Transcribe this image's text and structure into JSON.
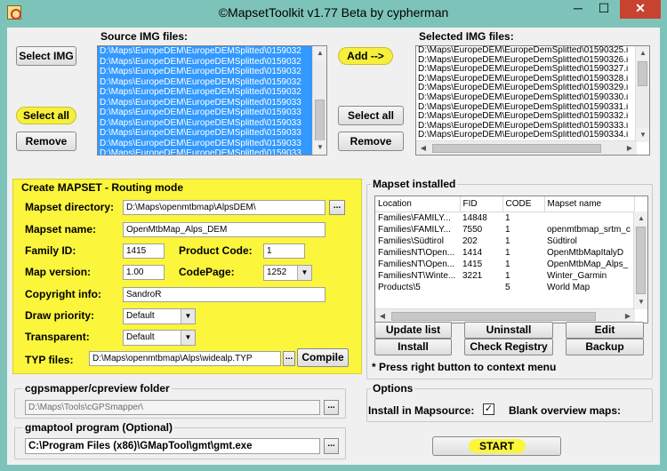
{
  "window": {
    "title": "©MapsetToolkit v1.77 Beta by cypherman",
    "minimize": "─",
    "maximize": "☐",
    "close": "✕"
  },
  "source": {
    "label": "Source IMG files:",
    "select_img": "Select IMG",
    "select_all": "Select all",
    "remove": "Remove",
    "files": [
      "D:\\Maps\\EuropeDEM\\EuropeDEMSplitted\\0159032",
      "D:\\Maps\\EuropeDEM\\EuropeDEMSplitted\\0159032",
      "D:\\Maps\\EuropeDEM\\EuropeDEMSplitted\\0159032",
      "D:\\Maps\\EuropeDEM\\EuropeDEMSplitted\\0159032",
      "D:\\Maps\\EuropeDEM\\EuropeDEMSplitted\\0159032",
      "D:\\Maps\\EuropeDEM\\EuropeDEMSplitted\\0159033",
      "D:\\Maps\\EuropeDEM\\EuropeDEMSplitted\\0159033",
      "D:\\Maps\\EuropeDEM\\EuropeDEMSplitted\\0159033",
      "D:\\Maps\\EuropeDEM\\EuropeDEMSplitted\\0159033",
      "D:\\Maps\\EuropeDEM\\EuropeDEMSplitted\\0159033",
      "D:\\Maps\\EuropeDEM\\EuropeDEMSplitted\\0159033"
    ]
  },
  "add_button": "Add -->",
  "selected": {
    "label": "Selected IMG files:",
    "select_all": "Select all",
    "remove": "Remove",
    "files": [
      "D:\\Maps\\EuropeDEM\\EuropeDemSplitted\\01590325.i",
      "D:\\Maps\\EuropeDEM\\EuropeDemSplitted\\01590326.i",
      "D:\\Maps\\EuropeDEM\\EuropeDemSplitted\\01590327.i",
      "D:\\Maps\\EuropeDEM\\EuropeDemSplitted\\01590328.i",
      "D:\\Maps\\EuropeDEM\\EuropeDemSplitted\\01590329.i",
      "D:\\Maps\\EuropeDEM\\EuropeDemSplitted\\01590330.i",
      "D:\\Maps\\EuropeDEM\\EuropeDemSplitted\\01590331.i",
      "D:\\Maps\\EuropeDEM\\EuropeDemSplitted\\01590332.i",
      "D:\\Maps\\EuropeDEM\\EuropeDemSplitted\\01590333.i",
      "D:\\Maps\\EuropeDEM\\EuropeDemSplitted\\01590334.i"
    ]
  },
  "create": {
    "title": "Create MAPSET - Routing mode",
    "mapset_directory_label": "Mapset directory:",
    "mapset_directory": "D:\\Maps\\openmtbmap\\AlpsDEM\\",
    "browse": "...",
    "mapset_name_label": "Mapset name:",
    "mapset_name": "OpenMtbMap_Alps_DEM",
    "family_id_label": "Family ID:",
    "family_id": "1415",
    "product_code_label": "Product Code:",
    "product_code": "1",
    "map_version_label": "Map version:",
    "map_version": "1.00",
    "codepage_label": "CodePage:",
    "codepage": "1252",
    "copyright_label": "Copyright info:",
    "copyright": "SandroR",
    "draw_priority_label": "Draw priority:",
    "draw_priority": "Default",
    "transparent_label": "Transparent:",
    "transparent": "Default",
    "typ_label": "TYP files:",
    "typ": "D:\\Maps\\openmtbmap\\Alps\\widealp.TYP",
    "compile": "Compile"
  },
  "installed": {
    "label": "Mapset installed",
    "columns": [
      "Location",
      "FID",
      "CODE",
      "Mapset name"
    ],
    "rows": [
      [
        "Families\\FAMILY...",
        "14848",
        "1",
        ""
      ],
      [
        "Families\\FAMILY...",
        "7550",
        "1",
        "openmtbmap_srtm_c"
      ],
      [
        "Families\\Südtirol",
        "202",
        "1",
        "Südtirol"
      ],
      [
        "FamiliesNT\\Open...",
        "1414",
        "1",
        "OpenMtbMapItalyD"
      ],
      [
        "FamiliesNT\\Open...",
        "1415",
        "1",
        "OpenMtbMap_Alps_"
      ],
      [
        "FamiliesNT\\Winte...",
        "3221",
        "1",
        "Winter_Garmin"
      ],
      [
        "Products\\5",
        "",
        "5",
        "World Map"
      ]
    ],
    "update_list": "Update list",
    "uninstall": "Uninstall",
    "edit": "Edit",
    "install": "Install",
    "check_registry": "Check Registry",
    "backup": "Backup",
    "hint": "* Press right button to context menu"
  },
  "cgps": {
    "label": "cgpsmapper/cpreview folder",
    "path": "D:\\Maps\\Tools\\cGPSmapper\\"
  },
  "gmaptool": {
    "label": "gmaptool program (Optional)",
    "path": "C:\\Program Files (x86)\\GMapTool\\gmt\\gmt.exe"
  },
  "options": {
    "label": "Options",
    "install_in_mapsource": "Install in Mapsource:",
    "install_checked": "✓",
    "blank_overview": "Blank overview maps:"
  },
  "start": "START",
  "colors": {
    "highlight": "#fbf53c",
    "selection": "#3399ff",
    "frame": "#7ec3ba",
    "close": "#c7432f"
  }
}
